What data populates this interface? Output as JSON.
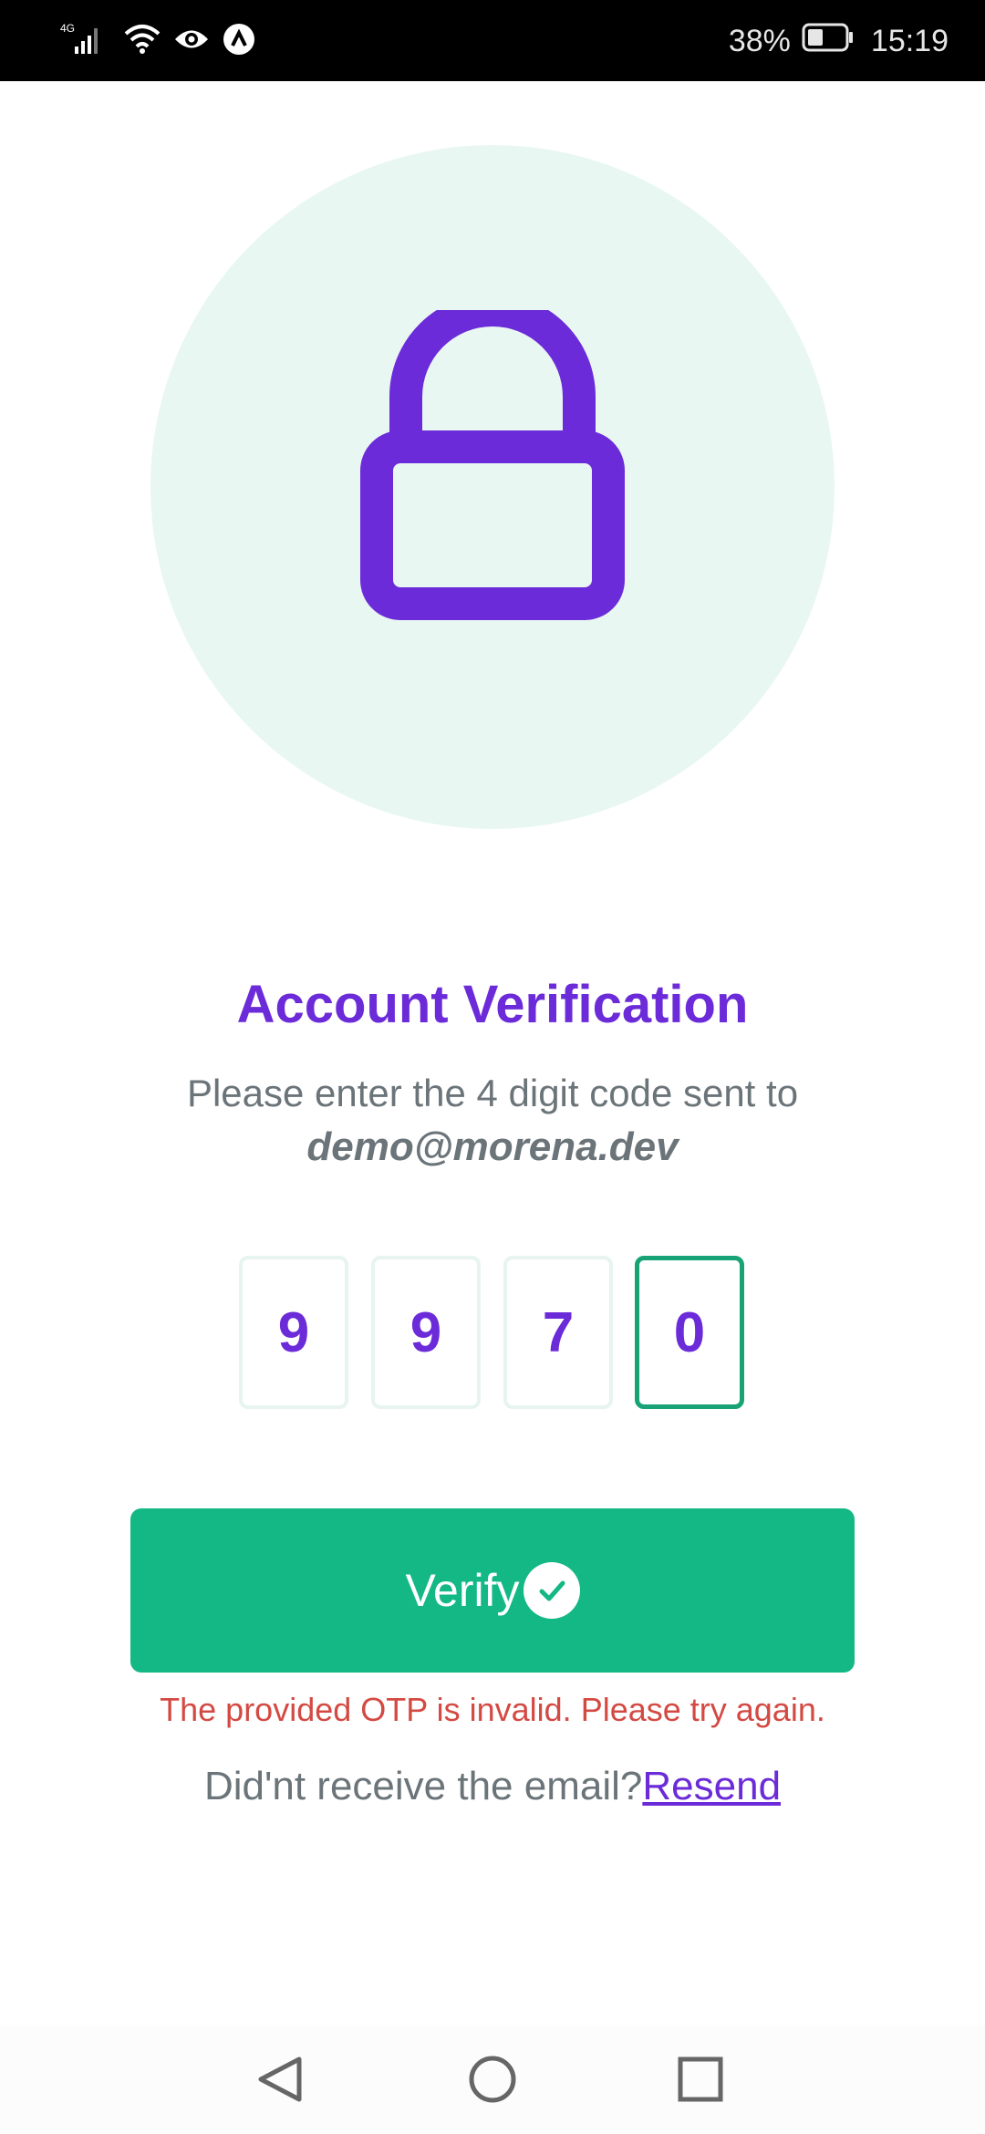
{
  "status_bar": {
    "network": "4G",
    "battery": "38%",
    "time": "15:19"
  },
  "hero": {
    "icon": "lock-icon",
    "circle_color": "#e8f7f1",
    "icon_color": "#6c2bd9"
  },
  "title": "Account Verification",
  "subtitle": "Please enter the 4 digit code sent to",
  "email": "demo@morena.dev",
  "otp": {
    "digits": [
      "9",
      "9",
      "7",
      "0"
    ],
    "active_index": 3
  },
  "verify_button": {
    "label": "Verify",
    "icon": "check-circle-icon",
    "color": "#13b885"
  },
  "error_message": "The provided OTP is invalid. Please try again.",
  "resend": {
    "prompt": "Did'nt receive the email?",
    "link_label": "Resend"
  },
  "nav": {
    "back_icon": "back-triangle-icon",
    "home_icon": "home-circle-icon",
    "recents_icon": "recents-square-icon"
  },
  "colors": {
    "accent": "#6c2bd9",
    "primary": "#13b885",
    "error": "#d34a43",
    "text_muted": "#6b7479"
  }
}
